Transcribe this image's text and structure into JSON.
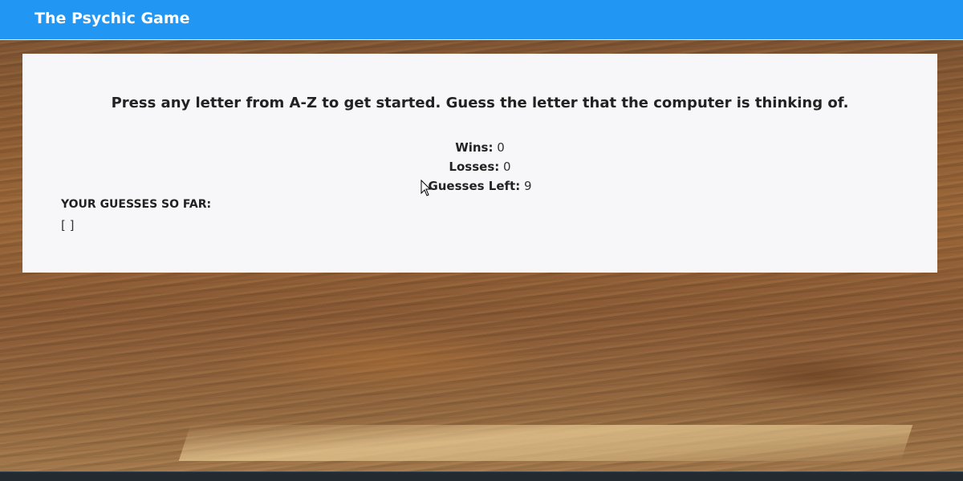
{
  "navbar": {
    "brand": "The Psychic Game",
    "color": "#2196f3"
  },
  "game": {
    "instructions": "Press any letter from A-Z to get started. Guess the letter that the computer is thinking of.",
    "stats": {
      "wins_label": "Wins:",
      "wins_value": "0",
      "losses_label": "Losses:",
      "losses_value": "0",
      "guesses_left_label": "Guesses Left:",
      "guesses_left_value": "9"
    },
    "guesses_title": "YOUR GUESSES SO FAR:",
    "guesses_value": "[ ]"
  },
  "background": "wood-texture"
}
